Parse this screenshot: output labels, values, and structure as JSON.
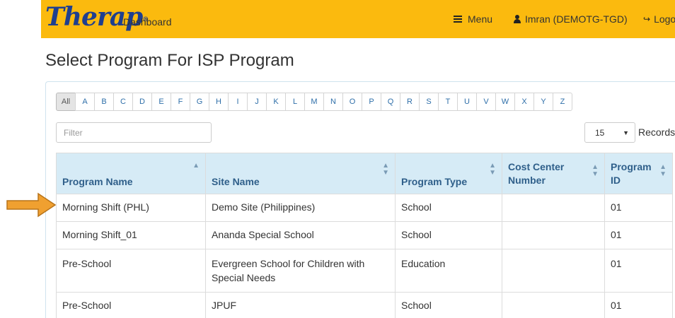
{
  "header": {
    "logo_text": "Therap",
    "dashboard_label": "Dashboard",
    "menu_label": "Menu",
    "user_label": "Imran (DEMOTG-TGD)",
    "logout_label": "Logo",
    "brand_color": "#fbba0e"
  },
  "page": {
    "title": "Select Program For ISP Program"
  },
  "alphabet": {
    "letters": [
      "All",
      "A",
      "B",
      "C",
      "D",
      "E",
      "F",
      "G",
      "H",
      "I",
      "J",
      "K",
      "L",
      "M",
      "N",
      "O",
      "P",
      "Q",
      "R",
      "S",
      "T",
      "U",
      "V",
      "W",
      "X",
      "Y",
      "Z"
    ],
    "active": "All"
  },
  "filter": {
    "placeholder": "Filter",
    "value": ""
  },
  "records": {
    "selected": "15",
    "label": "Records"
  },
  "table": {
    "columns": [
      {
        "label": "Program Name",
        "sort": "asc"
      },
      {
        "label": "Site Name",
        "sort": "both"
      },
      {
        "label": "Program Type",
        "sort": "both"
      },
      {
        "label": "Cost Center Number",
        "sort": "both"
      },
      {
        "label": "Program ID",
        "sort": "both"
      }
    ],
    "rows": [
      [
        "Morning Shift (PHL)",
        "Demo Site (Philippines)",
        "School",
        "",
        "01"
      ],
      [
        "Morning Shift_01",
        "Ananda Special School",
        "School",
        "",
        "01"
      ],
      [
        "Pre-School",
        "Evergreen School for Children with Special Needs",
        "Education",
        "",
        "01"
      ],
      [
        "Pre-School",
        "JPUF",
        "School",
        "",
        "01"
      ]
    ]
  },
  "annotation": {
    "arrow_color": "#f0a030",
    "arrow_icon": "arrow-right-icon"
  }
}
